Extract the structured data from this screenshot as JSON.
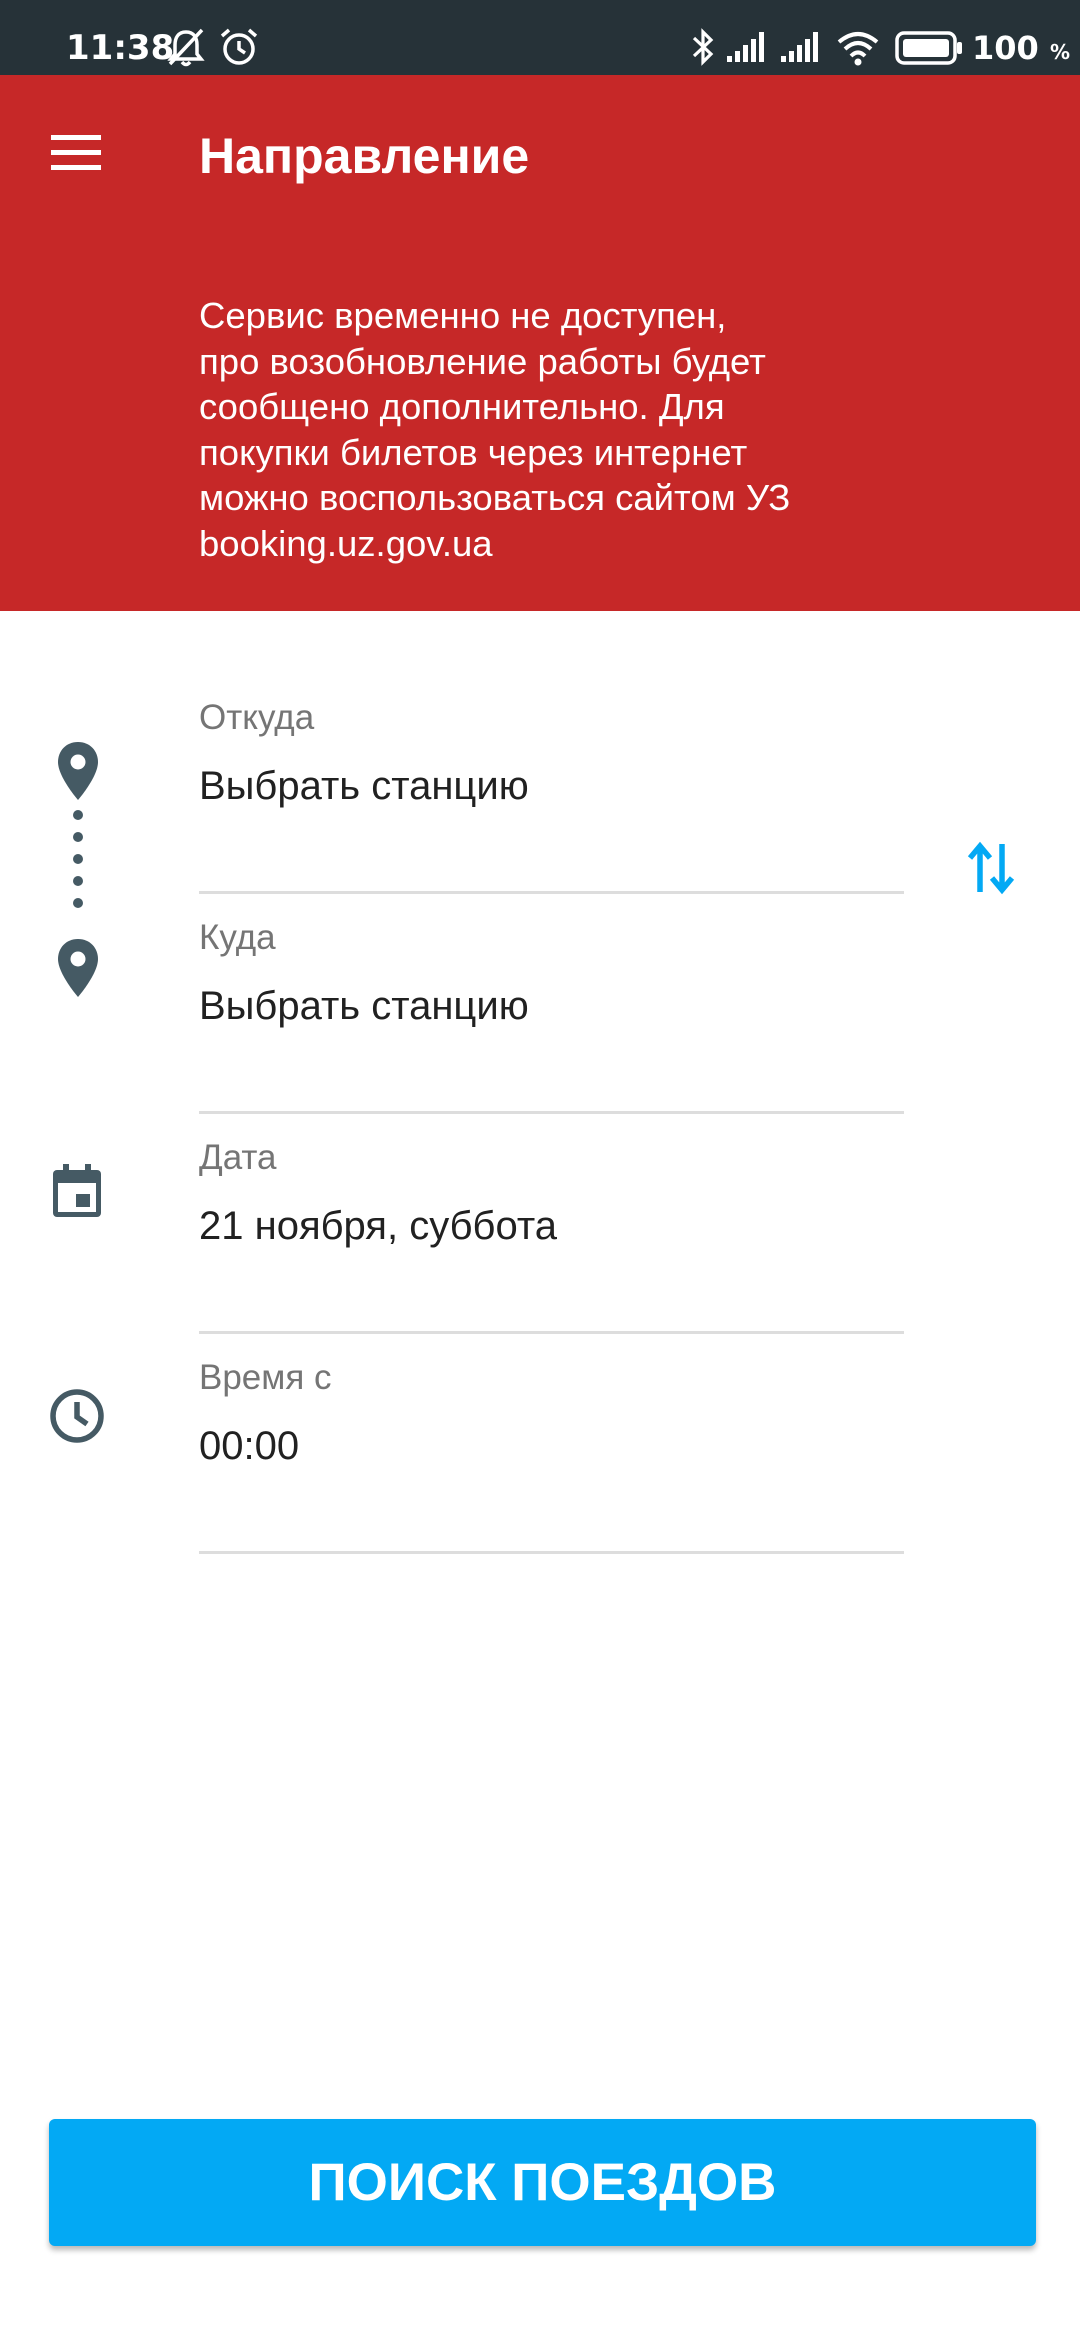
{
  "status_bar": {
    "time": "11:38",
    "battery_percent": "100",
    "battery_unit": "%",
    "icons": [
      "bell-off-icon",
      "alarm-icon",
      "bluetooth-icon",
      "signal-icon",
      "signal-icon",
      "wifi-icon",
      "battery-icon"
    ]
  },
  "header": {
    "title": "Направление",
    "notice": "Сервис временно не доступен,\nпро возобновление работы будет\nсообщено дополнительно. Для\nпокупки билетов через интернет\nможно воспользоваться сайтом УЗ\nbooking.uz.gov.ua",
    "background_color": "#c62828"
  },
  "form": {
    "from": {
      "label": "Откуда",
      "value": "Выбрать станцию"
    },
    "to": {
      "label": "Куда",
      "value": "Выбрать станцию"
    },
    "date": {
      "label": "Дата",
      "value": "21 ноября, суббота"
    },
    "time": {
      "label": "Время с",
      "value": "00:00"
    },
    "icon_color": "#455a64",
    "swap_icon_color": "#03a9f4"
  },
  "search_button": {
    "label": "ПОИСК ПОЕЗДОВ",
    "color": "#03a9f4"
  }
}
